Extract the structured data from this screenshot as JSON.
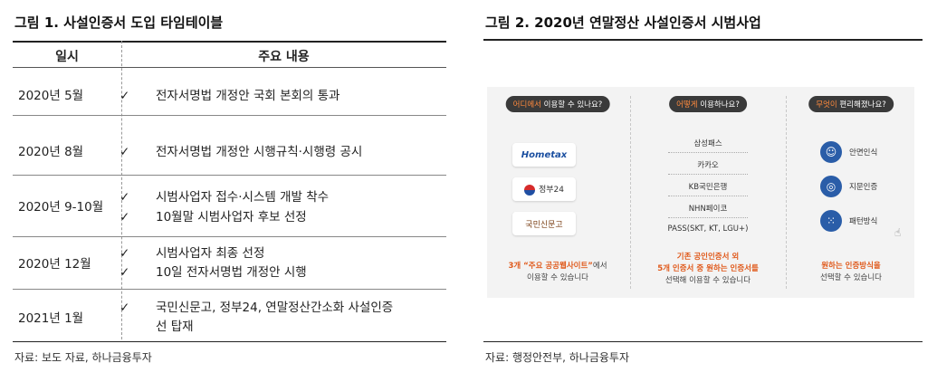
{
  "figure1": {
    "title": "그림 1. 사설인증서 도입 타임테이블",
    "col_date": "일시",
    "col_content": "주요 내용",
    "check": "✓",
    "rows": [
      {
        "date": "2020년 5월",
        "items": [
          "전자서명법 개정안 국회 본회의 통과"
        ]
      },
      {
        "date": "2020년 8월",
        "items": [
          "전자서명법 개정안 시행규칙·시행령 공시"
        ]
      },
      {
        "date": "2020년 9-10월",
        "items": [
          "시범사업자 접수·시스템 개발 착수",
          "10월말 시범사업자 후보 선정"
        ]
      },
      {
        "date": "2020년 12월",
        "items": [
          "시범사업자 최종 선정",
          "10일 전자서명법 개정안 시행"
        ]
      },
      {
        "date": "2021년 1월",
        "items": [
          "국민신문고, 정부24, 연말정산간소화 사설인증",
          "선 탑재"
        ]
      }
    ],
    "source": "자료: 보도 자료, 하나금융투자"
  },
  "figure2": {
    "title": "그림 2. 2020년 연말정산 사설인증서 시범사업",
    "source": "자료: 행정안전부, 하나금융투자",
    "col1": {
      "pill_em": "어디에서",
      "pill_rest": " 이용할 수 있나요?",
      "logos": [
        "Hometax",
        "정부24",
        "국민신문고"
      ],
      "note_line1_em": "3개 “주요 공공웹사이트”",
      "note_line1_rest": "에서",
      "note_line2": "이용할 수 있습니다"
    },
    "col2": {
      "pill_em": "어떻게",
      "pill_rest": " 이용하나요?",
      "options": [
        "삼성패스",
        "카카오",
        "KB국민은행",
        "NHN페이코",
        "PASS(SKT, KT, LGU+)"
      ],
      "note_line1": "기존 공인인증서 외",
      "note_line2": "5개 인증서 중 원하는 인증서를",
      "note_line3": "선택해 이용할 수 있습니다"
    },
    "col3": {
      "pill_em": "무엇이",
      "pill_rest": " 편리해졌나요?",
      "methods": [
        "안면인식",
        "지문인증",
        "패턴방식"
      ],
      "note_line1": "원하는 인증방식을",
      "note_line2": "선택할 수 있습니다"
    },
    "colors": {
      "accent": "#e05a1c",
      "pill": "#3a3a3a",
      "icon": "#2a5da8"
    }
  }
}
